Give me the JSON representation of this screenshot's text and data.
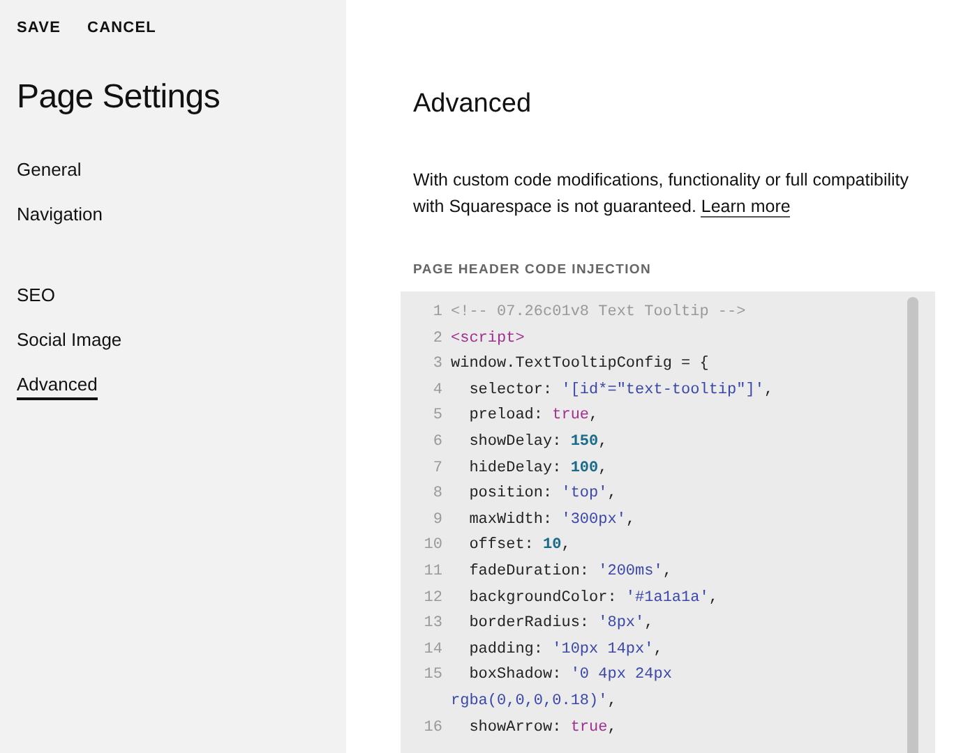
{
  "header_actions": [
    "SAVE",
    "CANCEL"
  ],
  "sidebar": {
    "title": "Page Settings",
    "groups": [
      {
        "items": [
          {
            "label": "General",
            "selected": false
          },
          {
            "label": "Navigation",
            "selected": false
          }
        ]
      },
      {
        "items": [
          {
            "label": "SEO",
            "selected": false
          },
          {
            "label": "Social Image",
            "selected": false
          },
          {
            "label": "Advanced",
            "selected": true
          }
        ]
      }
    ]
  },
  "main": {
    "title": "Advanced",
    "description": "With custom code modifications, functionality or full compatibility with Squarespace is not guaranteed.",
    "link": "Learn more",
    "section_label": "PAGE HEADER CODE INJECTION",
    "code_lines": [
      {
        "number": "1",
        "tokens": [
          {
            "kind": "comment",
            "text": "<!-- 07.26c01v8 Text Tooltip -->"
          }
        ]
      },
      {
        "number": "2",
        "tokens": [
          {
            "kind": "tag",
            "text": "<script>"
          }
        ]
      },
      {
        "number": "3",
        "tokens": [
          {
            "kind": "plain",
            "text": "window.TextTooltipConfig = {"
          }
        ]
      },
      {
        "number": "4",
        "tokens": [
          {
            "kind": "plain",
            "text": "  selector: "
          },
          {
            "kind": "string",
            "text": "'[id*=\"text-tooltip\"]'"
          },
          {
            "kind": "plain",
            "text": ","
          }
        ]
      },
      {
        "number": "5",
        "tokens": [
          {
            "kind": "plain",
            "text": "  preload: "
          },
          {
            "kind": "keyword",
            "text": "true"
          },
          {
            "kind": "plain",
            "text": ","
          }
        ]
      },
      {
        "number": "6",
        "tokens": [
          {
            "kind": "plain",
            "text": "  showDelay: "
          },
          {
            "kind": "number",
            "text": "150"
          },
          {
            "kind": "plain",
            "text": ","
          }
        ]
      },
      {
        "number": "7",
        "tokens": [
          {
            "kind": "plain",
            "text": "  hideDelay: "
          },
          {
            "kind": "number",
            "text": "100"
          },
          {
            "kind": "plain",
            "text": ","
          }
        ]
      },
      {
        "number": "8",
        "tokens": [
          {
            "kind": "plain",
            "text": "  position: "
          },
          {
            "kind": "string",
            "text": "'top'"
          },
          {
            "kind": "plain",
            "text": ","
          }
        ]
      },
      {
        "number": "9",
        "tokens": [
          {
            "kind": "plain",
            "text": "  maxWidth: "
          },
          {
            "kind": "string",
            "text": "'300px'"
          },
          {
            "kind": "plain",
            "text": ","
          }
        ]
      },
      {
        "number": "10",
        "tokens": [
          {
            "kind": "plain",
            "text": "  offset: "
          },
          {
            "kind": "number",
            "text": "10"
          },
          {
            "kind": "plain",
            "text": ","
          }
        ]
      },
      {
        "number": "11",
        "tokens": [
          {
            "kind": "plain",
            "text": "  fadeDuration: "
          },
          {
            "kind": "string",
            "text": "'200ms'"
          },
          {
            "kind": "plain",
            "text": ","
          }
        ]
      },
      {
        "number": "12",
        "tokens": [
          {
            "kind": "plain",
            "text": "  backgroundColor: "
          },
          {
            "kind": "string",
            "text": "'#1a1a1a'"
          },
          {
            "kind": "plain",
            "text": ","
          }
        ]
      },
      {
        "number": "13",
        "tokens": [
          {
            "kind": "plain",
            "text": "  borderRadius: "
          },
          {
            "kind": "string",
            "text": "'8px'"
          },
          {
            "kind": "plain",
            "text": ","
          }
        ]
      },
      {
        "number": "14",
        "tokens": [
          {
            "kind": "plain",
            "text": "  padding: "
          },
          {
            "kind": "string",
            "text": "'10px 14px'"
          },
          {
            "kind": "plain",
            "text": ","
          }
        ]
      },
      {
        "number": "15",
        "tokens": [
          {
            "kind": "plain",
            "text": "  boxShadow: "
          },
          {
            "kind": "string",
            "text": "'0 4px 24px rgba(0,0,0,0.18)'"
          },
          {
            "kind": "plain",
            "text": ","
          }
        ]
      },
      {
        "number": "16",
        "tokens": [
          {
            "kind": "plain",
            "text": "  showArrow: "
          },
          {
            "kind": "keyword",
            "text": "true"
          },
          {
            "kind": "plain",
            "text": ","
          }
        ]
      }
    ]
  }
}
